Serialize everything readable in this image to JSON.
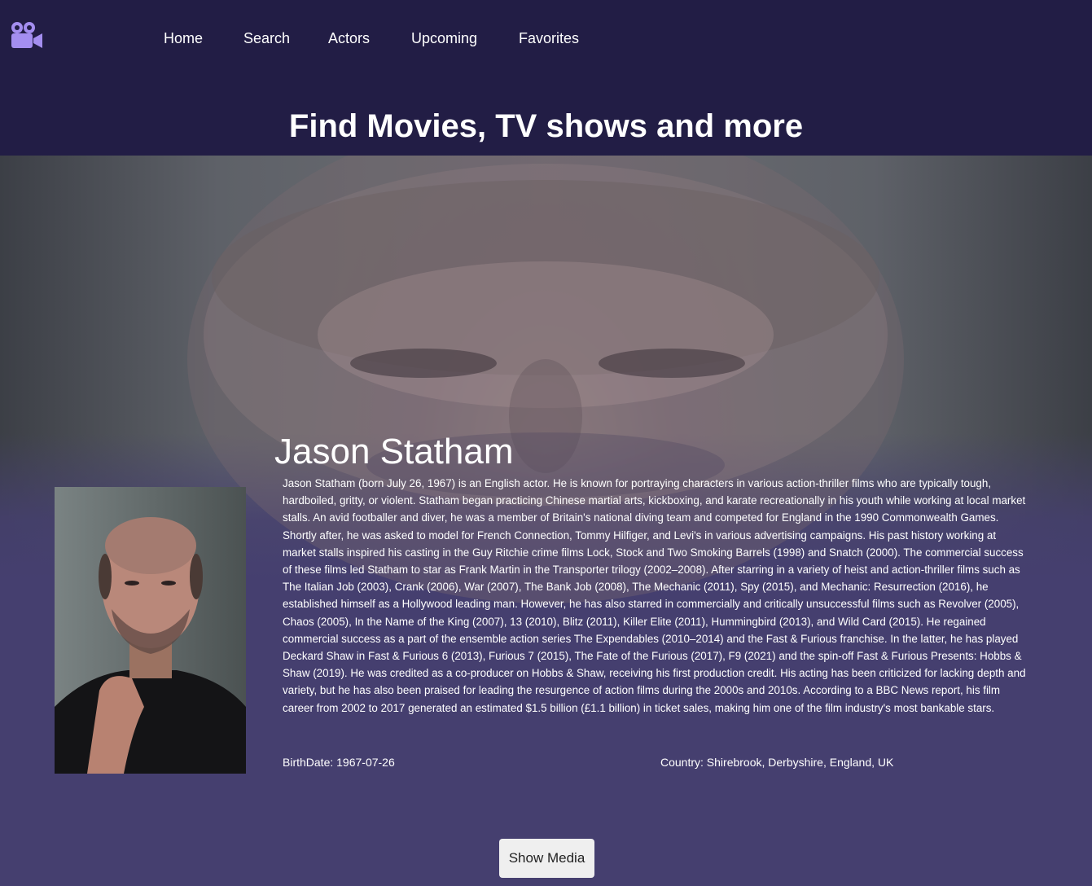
{
  "nav": {
    "logo_icon": "video-camera-icon",
    "items": [
      {
        "label": "Home"
      },
      {
        "label": "Search"
      },
      {
        "label": "Actors"
      },
      {
        "label": "Upcoming"
      },
      {
        "label": "Favorites"
      }
    ]
  },
  "hero": {
    "title": "Find Movies, TV shows and more"
  },
  "actor": {
    "name": "Jason Statham",
    "bio": "Jason Statham (born July 26, 1967) is an English actor. He is known for portraying characters in various action-thriller films who are typically tough, hardboiled, gritty, or violent. Statham began practicing Chinese martial arts, kickboxing, and karate recreationally in his youth while working at local market stalls. An avid footballer and diver, he was a member of Britain's national diving team and competed for England in the 1990 Commonwealth Games. Shortly after, he was asked to model for French Connection, Tommy Hilfiger, and Levi's in various advertising campaigns. His past history working at market stalls inspired his casting in the Guy Ritchie crime films Lock, Stock and Two Smoking Barrels (1998) and Snatch (2000). The commercial success of these films led Statham to star as Frank Martin in the Transporter trilogy (2002–2008). After starring in a variety of heist and action-thriller films such as The Italian Job (2003), Crank (2006), War (2007), The Bank Job (2008), The Mechanic (2011), Spy (2015), and Mechanic: Resurrection (2016), he established himself as a Hollywood leading man. However, he has also starred in commercially and critically unsuccessful films such as Revolver (2005), Chaos (2005), In the Name of the King (2007), 13 (2010), Blitz (2011), Killer Elite (2011), Hummingbird (2013), and Wild Card (2015). He regained commercial success as a part of the ensemble action series The Expendables (2010–2014) and the Fast & Furious franchise. In the latter, he has played Deckard Shaw in Fast & Furious 6 (2013), Furious 7 (2015), The Fate of the Furious (2017), F9 (2021) and the spin-off Fast & Furious Presents: Hobbs & Shaw (2019). He was credited as a co-producer on Hobbs & Shaw, receiving his first production credit. His acting has been criticized for lacking depth and variety, but he has also been praised for leading the resurgence of action films during the 2000s and 2010s. According to a BBC News report, his film career from 2002 to 2017 generated an estimated $1.5 billion (£1.1 billion) in ticket sales, making him one of the film industry's most bankable stars.",
    "birthdate_text": "BirthDate: 1967-07-26",
    "country_text": "Country: Shirebrook, Derbyshire, England, UK"
  },
  "actions": {
    "show_media_label": "Show Media"
  },
  "colors": {
    "header_bg": "#221d45",
    "page_bg": "#453f6f",
    "logo": "#a48ef0",
    "button_bg": "#efefef"
  }
}
